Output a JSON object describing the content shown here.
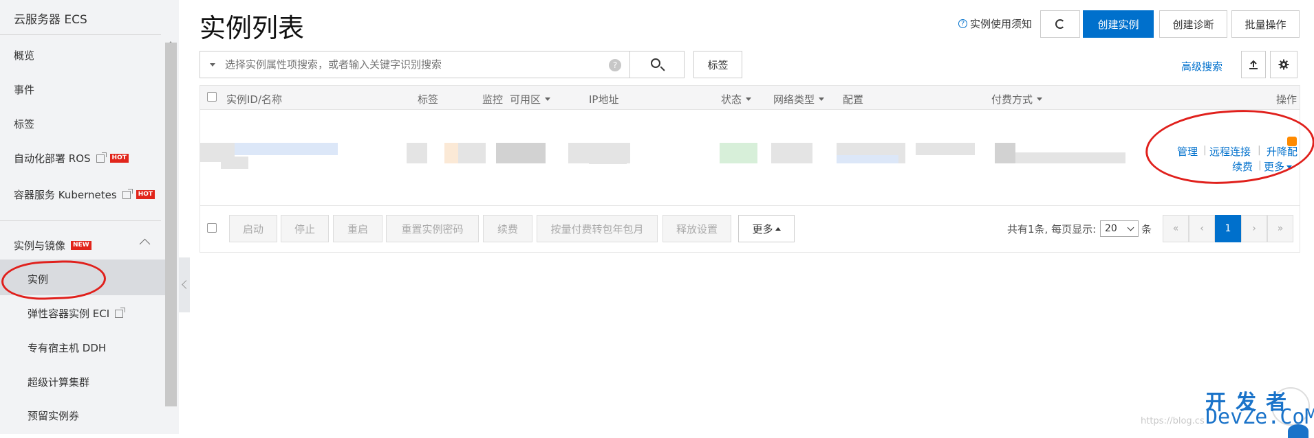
{
  "sidebar": {
    "title": "云服务器 ECS",
    "items": [
      {
        "label": "概览"
      },
      {
        "label": "事件"
      },
      {
        "label": "标签"
      },
      {
        "label": "自动化部署 ROS",
        "badge": "HOT"
      },
      {
        "label": "容器服务 Kubernetes",
        "badge": "HOT"
      }
    ],
    "group": {
      "label": "实例与镜像",
      "badge": "NEW"
    },
    "sub_items": [
      {
        "label": "实例"
      },
      {
        "label": "弹性容器实例 ECI"
      },
      {
        "label": "专有宿主机 DDH"
      },
      {
        "label": "超级计算集群"
      },
      {
        "label": "预留实例券"
      }
    ]
  },
  "header": {
    "title": "实例列表",
    "notice": "实例使用须知",
    "create_instance": "创建实例",
    "create_diagnosis": "创建诊断",
    "batch_ops": "批量操作"
  },
  "search": {
    "placeholder": "选择实例属性项搜索，或者输入关键字识别搜索",
    "tag_button": "标签",
    "advanced": "高级搜索"
  },
  "table": {
    "columns": [
      "实例ID/名称",
      "标签",
      "监控",
      "可用区",
      "IP地址",
      "状态",
      "网络类型",
      "配置",
      "付费方式",
      "操作"
    ],
    "row_ops": {
      "manage": "管理",
      "remote": "远程连接",
      "upgrade": "升降配",
      "renew": "续费",
      "more": "更多"
    }
  },
  "footer": {
    "buttons": [
      "启动",
      "停止",
      "重启",
      "重置实例密码",
      "续费",
      "按量付费转包年包月",
      "释放设置"
    ],
    "more": "更多",
    "total_text": "共有1条, 每页显示:",
    "page_size": "20",
    "unit": "条",
    "pager": [
      "«",
      "‹",
      "1",
      "›",
      "»"
    ]
  },
  "watermark": {
    "url": "https://blog.cs",
    "cn": "开发者",
    "en": "DevZe.CoM"
  },
  "colors": {
    "accent": "#0070cc",
    "annotation_red": "#e0201c",
    "hot_badge": "#e1251b"
  }
}
